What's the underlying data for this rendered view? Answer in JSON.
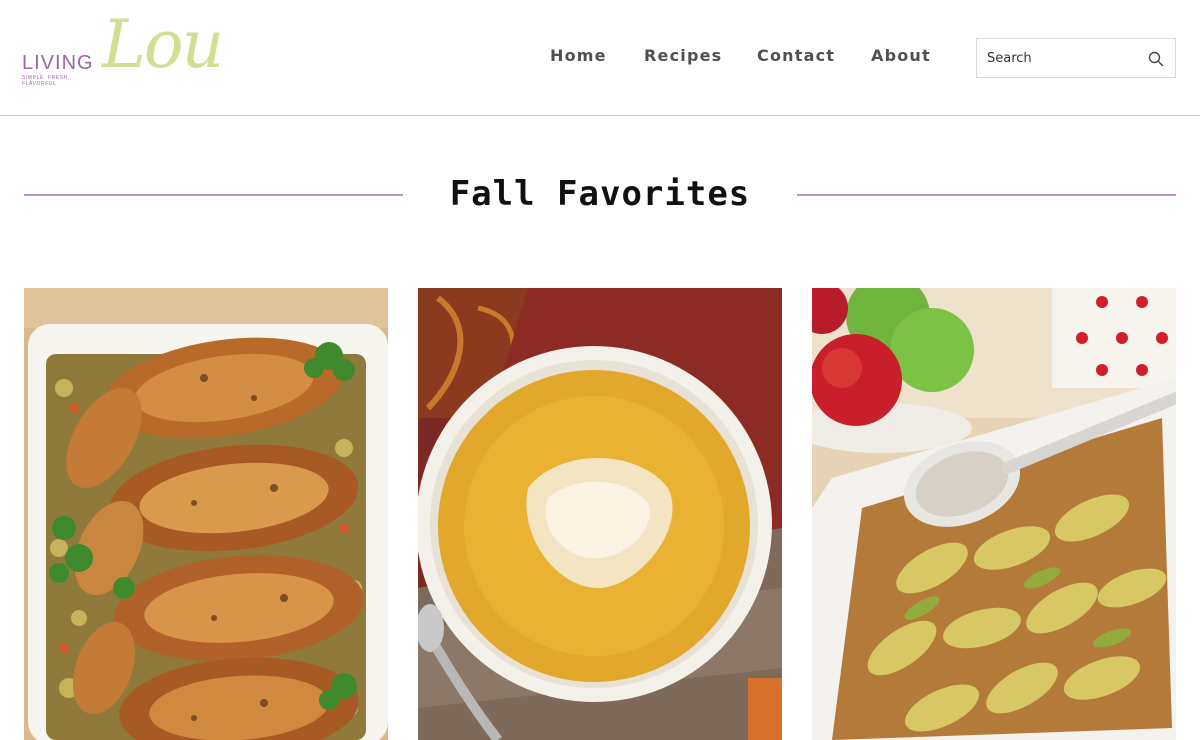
{
  "site": {
    "logo_word": "LIVING",
    "logo_script": "Lou",
    "logo_tagline": "SIMPLE. FRESH. FLAVORFUL"
  },
  "nav": {
    "items": [
      {
        "label": "Home"
      },
      {
        "label": "Recipes"
      },
      {
        "label": "Contact"
      },
      {
        "label": "About"
      }
    ]
  },
  "search": {
    "placeholder": "Search",
    "icon": "search-icon"
  },
  "section": {
    "title": "Fall Favorites"
  },
  "colors": {
    "accent_purple": "#b992c8",
    "logo_green": "#cfe093",
    "logo_purple": "#a064a8"
  },
  "cards": [
    {
      "image": "roast-chicken-image"
    },
    {
      "image": "butternut-soup-image"
    },
    {
      "image": "baked-apples-image"
    }
  ]
}
